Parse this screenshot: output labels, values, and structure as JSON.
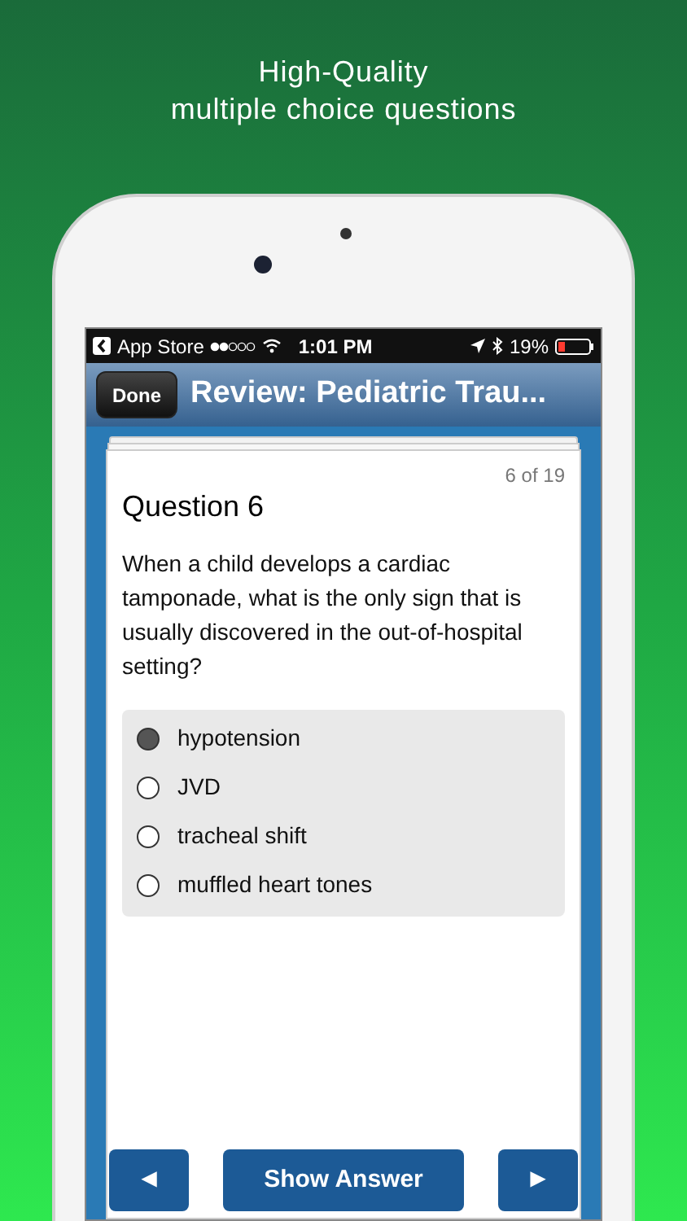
{
  "headline": [
    "High-Quality",
    "multiple choice questions"
  ],
  "status_bar": {
    "back_label": "App Store",
    "time": "1:01 PM",
    "battery": "19%"
  },
  "nav": {
    "done_button": "Done",
    "title": "Review: Pediatric Trau..."
  },
  "question": {
    "counter": "6 of 19",
    "title": "Question 6",
    "text": "When a child develops a cardiac tamponade, what is the only sign that is usually discovered in the out-of-hospital setting?"
  },
  "options": [
    {
      "label": "hypotension",
      "selected": true
    },
    {
      "label": "JVD",
      "selected": false
    },
    {
      "label": "tracheal shift",
      "selected": false
    },
    {
      "label": "muffled heart tones",
      "selected": false
    }
  ],
  "buttons": {
    "previous": "◄",
    "show_answer": "Show Answer",
    "next": "►"
  }
}
